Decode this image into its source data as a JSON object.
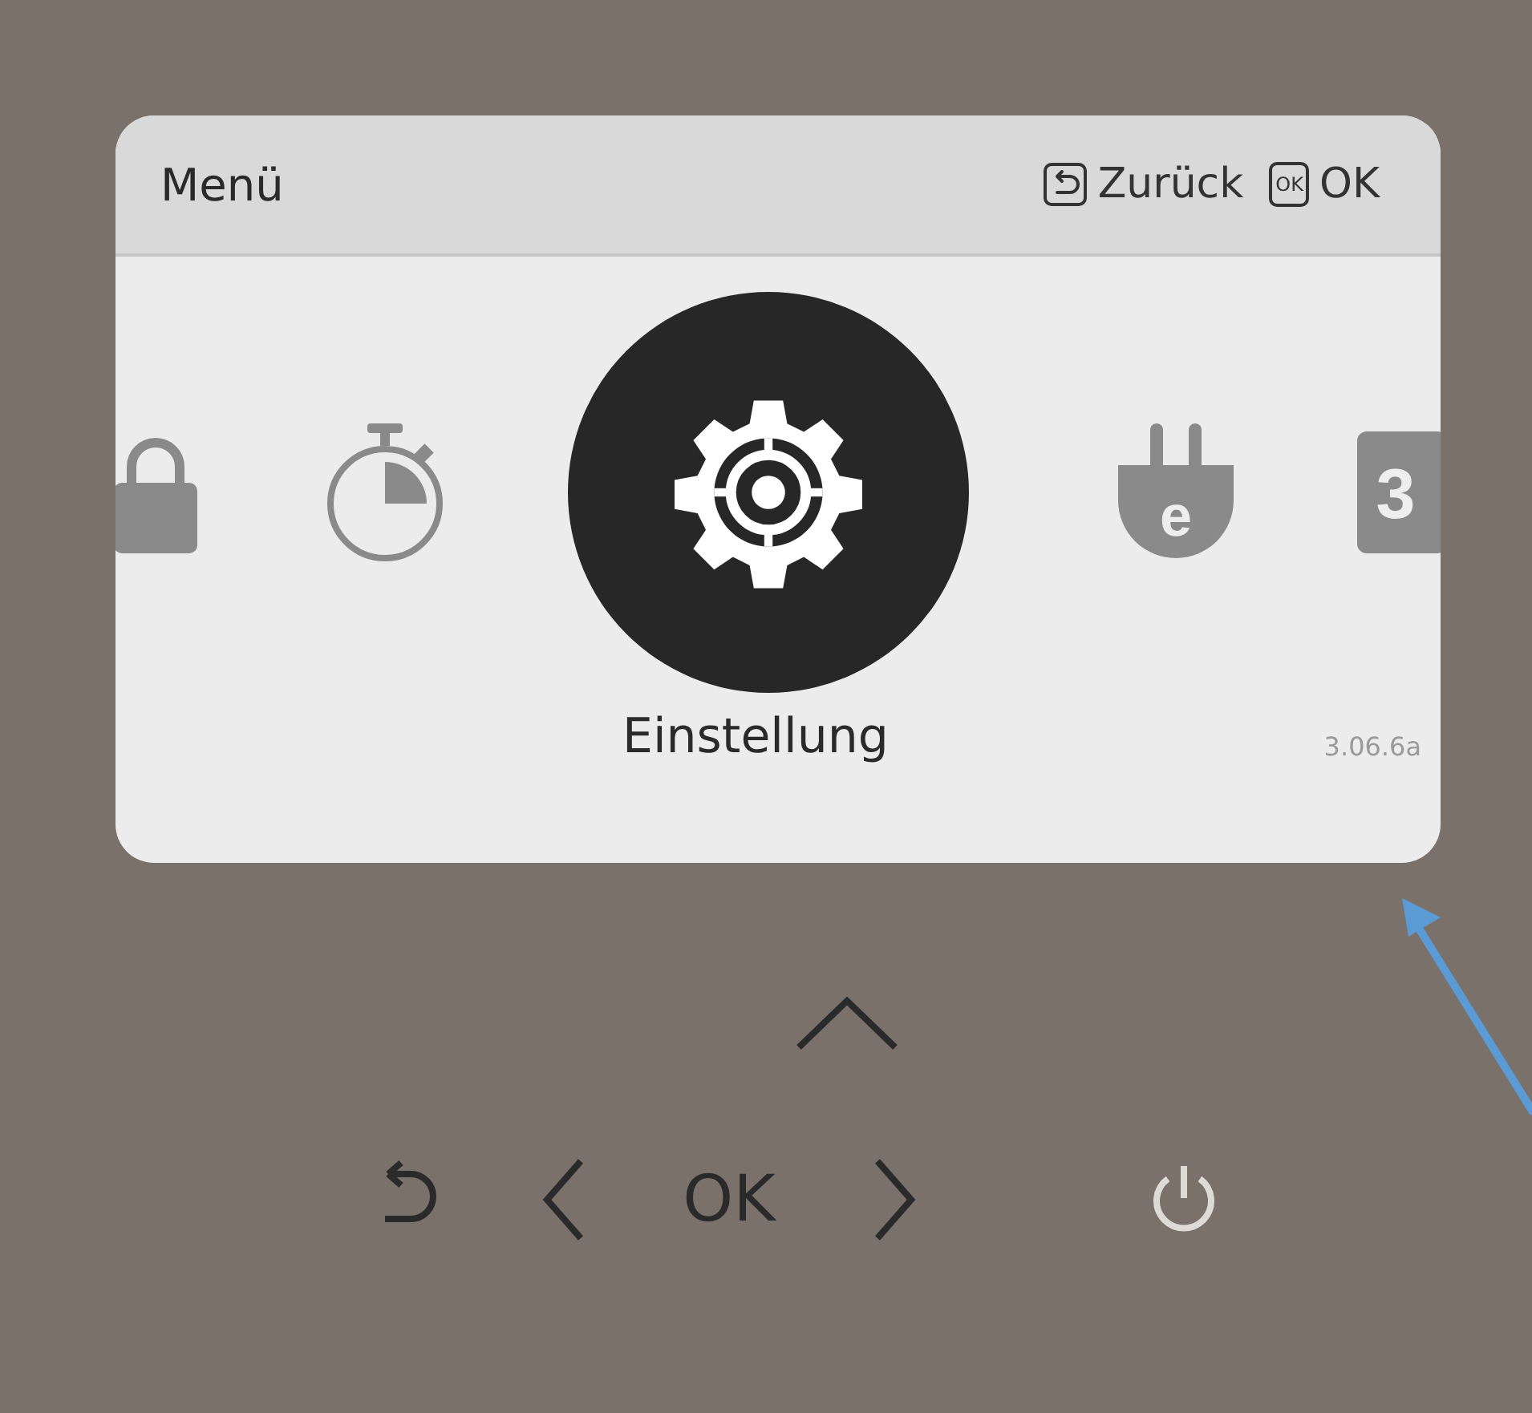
{
  "screen": {
    "title": "Menü",
    "back_label": "Zurück",
    "ok_key": "OK",
    "ok_label": "OK",
    "menu_items": [
      {
        "kind": "lock",
        "selected": false
      },
      {
        "kind": "timer",
        "selected": false
      },
      {
        "kind": "settings",
        "selected": true,
        "label": "Einstellung"
      },
      {
        "kind": "plug",
        "selected": false,
        "glyph": "e"
      },
      {
        "kind": "calendar",
        "selected": false,
        "glyph": "3"
      }
    ],
    "version": "3.06.6a"
  },
  "keypad": {
    "ok_label": "OK"
  }
}
